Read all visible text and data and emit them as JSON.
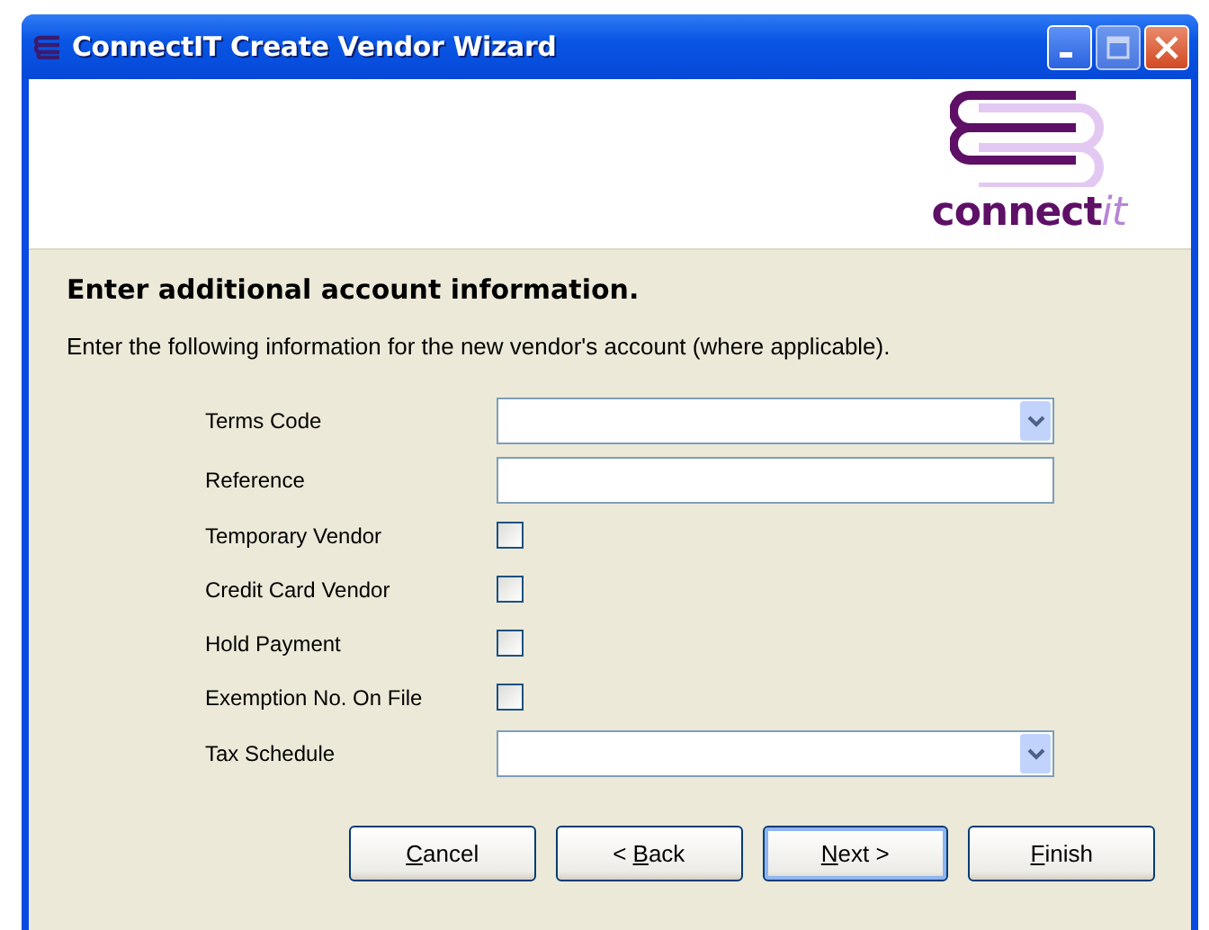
{
  "window": {
    "title": "ConnectIT Create Vendor Wizard"
  },
  "header": {
    "logo_main": "connect",
    "logo_accent": "it"
  },
  "page": {
    "heading": "Enter additional account information.",
    "description": "Enter the following information for the new vendor's account (where applicable)."
  },
  "fields": [
    {
      "kind": "combo",
      "label": "Terms Code"
    },
    {
      "kind": "text",
      "label": "Reference"
    },
    {
      "kind": "checkbox",
      "label": "Temporary Vendor",
      "checked": false
    },
    {
      "kind": "checkbox",
      "label": "Credit Card Vendor",
      "checked": false
    },
    {
      "kind": "checkbox",
      "label": "Hold Payment",
      "checked": false
    },
    {
      "kind": "checkbox",
      "label": "Exemption No. On File",
      "checked": false
    },
    {
      "kind": "combo",
      "label": "Tax Schedule"
    }
  ],
  "buttons": [
    {
      "key": "C",
      "after": "ancel",
      "default": false
    },
    {
      "before": "< ",
      "key": "B",
      "after": "ack",
      "default": false
    },
    {
      "key": "N",
      "after": "ext >",
      "default": true
    },
    {
      "key": "F",
      "after": "inish",
      "default": false
    }
  ]
}
